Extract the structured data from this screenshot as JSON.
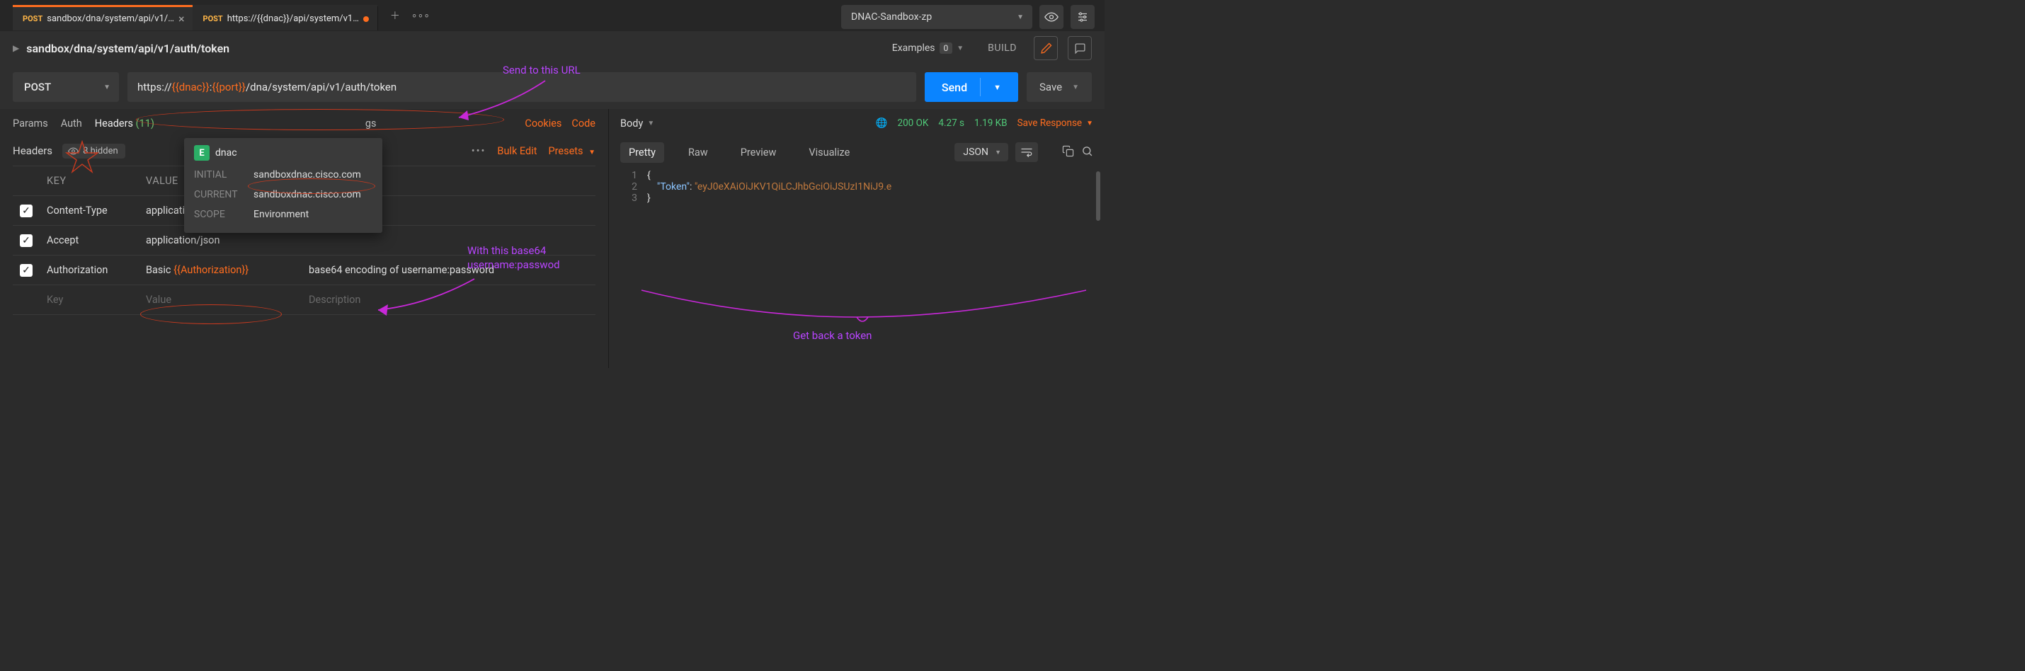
{
  "tabs": [
    {
      "method": "POST",
      "title": "sandbox/dna/system/api/v1/…",
      "active": true,
      "dirty": false
    },
    {
      "method": "POST",
      "title": "https://{{dnac}}/api/system/v1…",
      "active": false,
      "dirty": true
    }
  ],
  "env_selector": "DNAC-Sandbox-zp",
  "breadcrumb": "sandbox/dna/system/api/v1/auth/token",
  "examples_label": "Examples",
  "examples_count": "0",
  "build_label": "BUILD",
  "method": "POST",
  "url": {
    "pre": "https://",
    "v1": "{{dnac}}",
    "mid": ":",
    "v2": "{{port}}",
    "post": "/dna/system/api/v1/auth/token"
  },
  "send_label": "Send",
  "save_label": "Save",
  "subtabs": {
    "params": "Params",
    "auth": "Auth",
    "headers": "Headers",
    "headers_count": "(11)",
    "gs": "gs"
  },
  "cookies": "Cookies",
  "code": "Code",
  "headers_section": {
    "title": "Headers",
    "hidden": "8 hidden"
  },
  "header_tools": {
    "bulk": "Bulk Edit",
    "presets": "Presets"
  },
  "kv_head": {
    "key": "KEY",
    "value": "VALUE"
  },
  "rows": [
    {
      "key": "Content-Type",
      "value_raw": "application/json",
      "desc": ""
    },
    {
      "key": "Accept",
      "value_raw": "application/json",
      "desc": ""
    },
    {
      "key": "Authorization",
      "value_pre": "Basic ",
      "value_var": "{{Authorization}}",
      "desc": "base64 encoding of username:password"
    }
  ],
  "placeholder_row": {
    "key": "Key",
    "value": "Value",
    "desc": "Description"
  },
  "var_popover": {
    "badge": "E",
    "name": "dnac",
    "initial_lbl": "INITIAL",
    "initial_val": "sandboxdnac.cisco.com",
    "current_lbl": "CURRENT",
    "current_val": "sandboxdnac.cisco.com",
    "scope_lbl": "SCOPE",
    "scope_val": "Environment"
  },
  "annotations": {
    "send_url": "Send to this URL",
    "base64_1": "With this base64",
    "base64_2": "username:passwod",
    "get_token": "Get back a token"
  },
  "response": {
    "body_label": "Body",
    "status_code": "200 OK",
    "time": "4.27 s",
    "size": "1.19 KB",
    "save": "Save Response",
    "tabs": {
      "pretty": "Pretty",
      "raw": "Raw",
      "preview": "Preview",
      "visualize": "Visualize"
    },
    "format": "JSON",
    "lines": {
      "l1": "{",
      "l2k": "\"Token\"",
      "l2sep": ": ",
      "l2v": "\"eyJ0eXAiOiJKV1QiLCJhbGciOiJSUzI1NiJ9.e",
      "l3": "}"
    }
  }
}
